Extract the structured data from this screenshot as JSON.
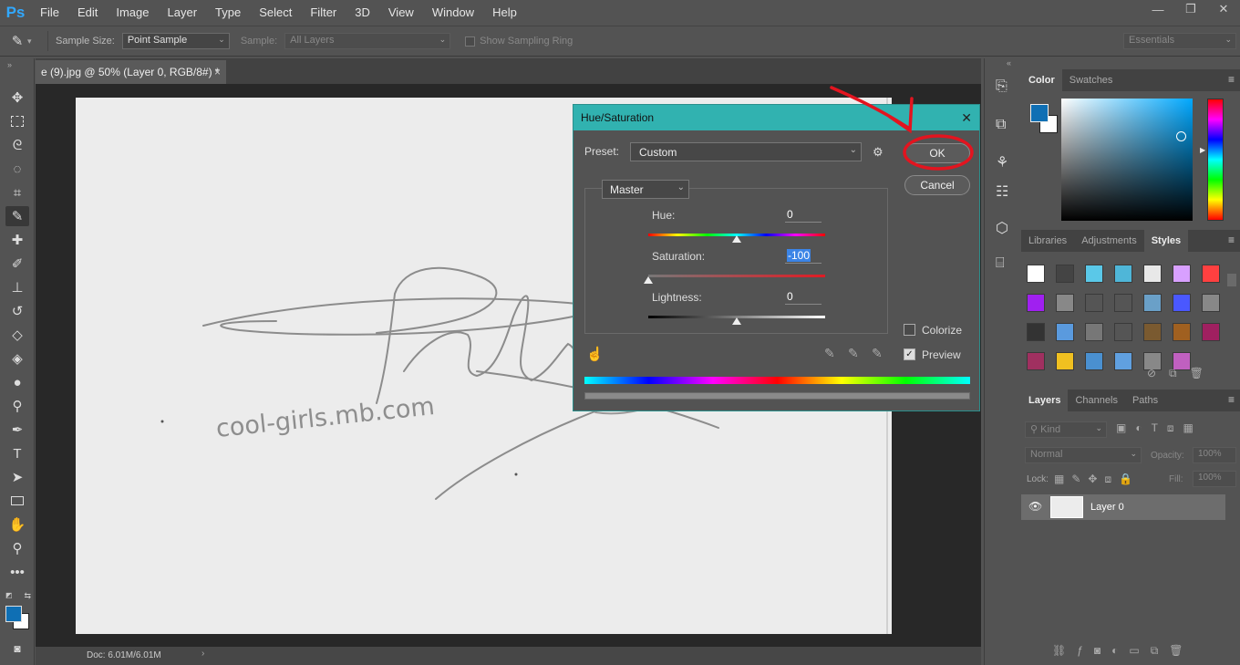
{
  "app": {
    "logo": "Ps"
  },
  "menu": [
    "File",
    "Edit",
    "Image",
    "Layer",
    "Type",
    "Select",
    "Filter",
    "3D",
    "View",
    "Window",
    "Help"
  ],
  "window_controls": {
    "minimize": "—",
    "restore": "❐",
    "close": "✕"
  },
  "options": {
    "sample_size_label": "Sample Size:",
    "sample_size_value": "Point Sample",
    "sample_label": "Sample:",
    "sample_value": "All Layers",
    "sampling_ring_label": "Show Sampling Ring",
    "workspace": "Essentials"
  },
  "document": {
    "tab_title": "e (9).jpg @ 50% (Layer 0, RGB/8#) *",
    "tab_close": "×",
    "status": "Doc: 6.01M/6.01M",
    "watermark": "cool-girls.mb.com"
  },
  "dialog": {
    "title": "Hue/Saturation",
    "close": "✕",
    "preset_label": "Preset:",
    "preset_value": "Custom",
    "channel": "Master",
    "hue_label": "Hue:",
    "hue_value": "0",
    "saturation_label": "Saturation:",
    "saturation_value": "-100",
    "lightness_label": "Lightness:",
    "lightness_value": "0",
    "ok": "OK",
    "cancel": "Cancel",
    "colorize_label": "Colorize",
    "colorize_checked": false,
    "preview_label": "Preview",
    "preview_checked": true,
    "hue_fraction": 0.5,
    "saturation_fraction": 0.0,
    "lightness_fraction": 0.5
  },
  "color_panel": {
    "tabs": [
      "Color",
      "Swatches"
    ],
    "foreground": "#0f6fb4",
    "background": "#ffffff"
  },
  "styles_panel": {
    "tabs": [
      "Libraries",
      "Adjustments",
      "Styles"
    ]
  },
  "layers_panel": {
    "tabs": [
      "Layers",
      "Channels",
      "Paths"
    ],
    "kind_label": "Kind",
    "blend_mode": "Normal",
    "opacity_label": "Opacity:",
    "opacity_value": "100%",
    "lock_label": "Lock:",
    "fill_label": "Fill:",
    "fill_value": "100%",
    "layers": [
      {
        "name": "Layer 0",
        "visible": true
      }
    ]
  }
}
